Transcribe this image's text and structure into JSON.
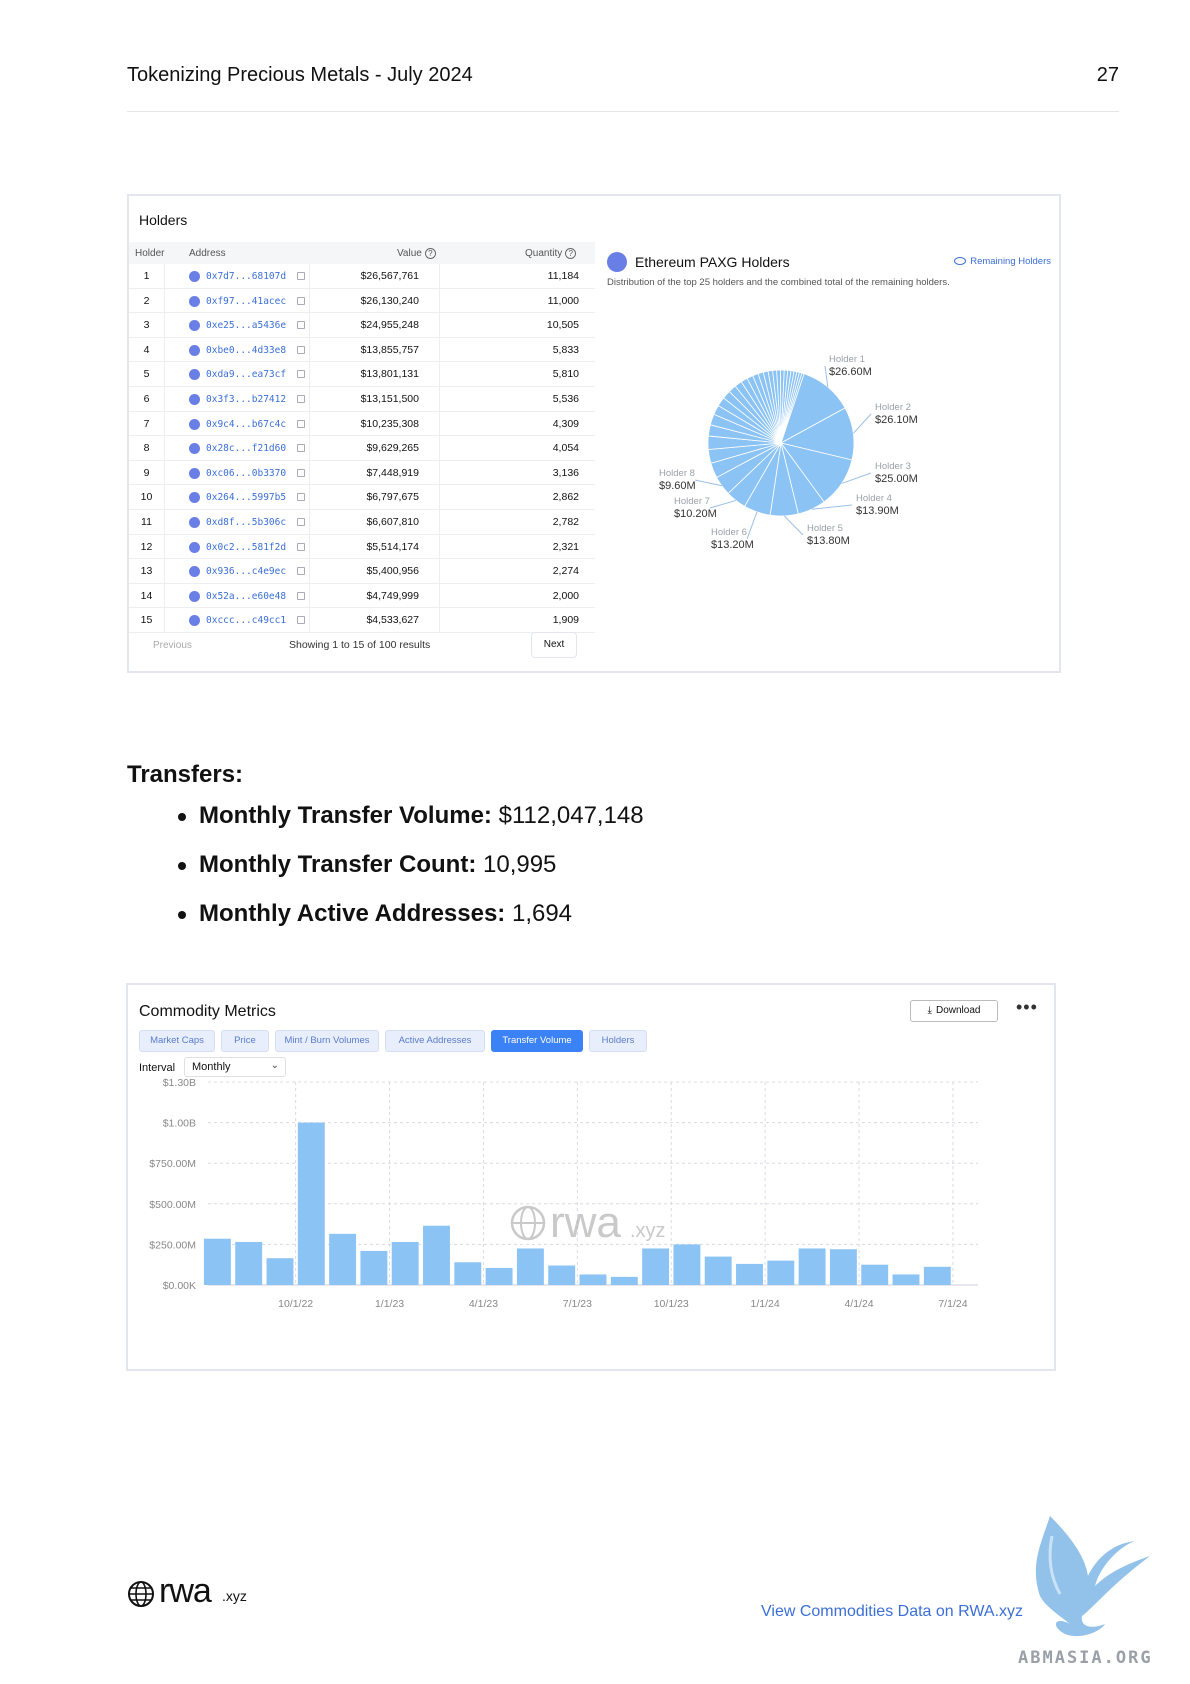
{
  "header": {
    "doc_title": "Tokenizing Precious Metals - July 2024",
    "page_number": "27"
  },
  "holders": {
    "panel_title": "Holders",
    "columns": {
      "holder": "Holder",
      "address": "Address",
      "value": "Value",
      "quantity": "Quantity"
    },
    "rows": [
      {
        "rank": "1",
        "address": "0x7d7...68107d",
        "value": "$26,567,761",
        "quantity": "11,184"
      },
      {
        "rank": "2",
        "address": "0xf97...41acec",
        "value": "$26,130,240",
        "quantity": "11,000"
      },
      {
        "rank": "3",
        "address": "0xe25...a5436e",
        "value": "$24,955,248",
        "quantity": "10,505"
      },
      {
        "rank": "4",
        "address": "0xbe0...4d33e8",
        "value": "$13,855,757",
        "quantity": "5,833"
      },
      {
        "rank": "5",
        "address": "0xda9...ea73cf",
        "value": "$13,801,131",
        "quantity": "5,810"
      },
      {
        "rank": "6",
        "address": "0x3f3...b27412",
        "value": "$13,151,500",
        "quantity": "5,536"
      },
      {
        "rank": "7",
        "address": "0x9c4...b67c4c",
        "value": "$10,235,308",
        "quantity": "4,309"
      },
      {
        "rank": "8",
        "address": "0x28c...f21d60",
        "value": "$9,629,265",
        "quantity": "4,054"
      },
      {
        "rank": "9",
        "address": "0xc06...0b3370",
        "value": "$7,448,919",
        "quantity": "3,136"
      },
      {
        "rank": "10",
        "address": "0x264...5997b5",
        "value": "$6,797,675",
        "quantity": "2,862"
      },
      {
        "rank": "11",
        "address": "0xd8f...5b306c",
        "value": "$6,607,810",
        "quantity": "2,782"
      },
      {
        "rank": "12",
        "address": "0x0c2...581f2d",
        "value": "$5,514,174",
        "quantity": "2,321"
      },
      {
        "rank": "13",
        "address": "0x936...c4e9ec",
        "value": "$5,400,956",
        "quantity": "2,274"
      },
      {
        "rank": "14",
        "address": "0x52a...e60e48",
        "value": "$4,749,999",
        "quantity": "2,000"
      },
      {
        "rank": "15",
        "address": "0xccc...c49cc1",
        "value": "$4,533,627",
        "quantity": "1,909"
      }
    ],
    "pager": {
      "previous": "Previous",
      "showing": "Showing 1 to 15 of 100 results",
      "next": "Next"
    }
  },
  "pie": {
    "title": "Ethereum PAXG Holders",
    "subtitle": "Distribution of the top 25 holders and the combined total of the remaining holders.",
    "remaining_link": "Remaining Holders",
    "color": "#8cc3f5"
  },
  "transfers": {
    "heading": "Transfers:",
    "items": [
      {
        "label": "Monthly Transfer Volume:",
        "value": " $112,047,148"
      },
      {
        "label": "Monthly Transfer Count:",
        "value": " 10,995"
      },
      {
        "label": "Monthly Active Addresses:",
        "value": " 1,694"
      }
    ]
  },
  "metrics": {
    "title": "Commodity Metrics",
    "download": "Download",
    "tabs": [
      "Market Caps",
      "Price",
      "Mint / Burn Volumes",
      "Active Addresses",
      "Transfer Volume",
      "Holders"
    ],
    "active_tab": "Transfer Volume",
    "interval_label": "Interval",
    "interval_value": "Monthly",
    "watermark": {
      "main": "rwa",
      "suffix": ".xyz"
    }
  },
  "chart_data": [
    {
      "type": "pie",
      "title": "Ethereum PAXG Holders",
      "slices": [
        {
          "label": "Holder 1",
          "value": 26.6,
          "display": "$26.60M"
        },
        {
          "label": "Holder 2",
          "value": 26.1,
          "display": "$26.10M"
        },
        {
          "label": "Holder 3",
          "value": 25.0,
          "display": "$25.00M"
        },
        {
          "label": "Holder 4",
          "value": 13.9,
          "display": "$13.90M"
        },
        {
          "label": "Holder 5",
          "value": 13.8,
          "display": "$13.80M"
        },
        {
          "label": "Holder 6",
          "value": 13.2,
          "display": "$13.20M"
        },
        {
          "label": "Holder 7",
          "value": 10.2,
          "display": "$10.20M"
        },
        {
          "label": "Holder 8",
          "value": 9.6,
          "display": "$9.60M"
        }
      ],
      "small_slices": [
        7.45,
        6.8,
        6.61,
        5.51,
        5.4,
        4.75,
        4.53,
        4.2,
        3.9,
        3.6,
        3.3,
        3.0,
        2.8,
        2.6,
        2.4,
        2.2,
        2.0,
        1.9,
        1.8,
        1.7,
        1.6,
        1.5,
        1.4,
        1.3,
        1.2,
        1.1
      ]
    },
    {
      "type": "bar",
      "title": "Transfer Volume",
      "y_ticks": [
        "$0.00K",
        "$250.00M",
        "$500.00M",
        "$750.00M",
        "$1.00B",
        "$1.30B"
      ],
      "y_tick_values": [
        0,
        250,
        500,
        750,
        1000,
        1250
      ],
      "ylim": [
        0,
        1250
      ],
      "x_ticks": [
        "10/1/22",
        "1/1/23",
        "4/1/23",
        "7/1/23",
        "10/1/23",
        "1/1/24",
        "4/1/24",
        "7/1/24"
      ],
      "x_tick_index": [
        2.5,
        5.5,
        8.5,
        11.5,
        14.5,
        17.5,
        20.5,
        23.5
      ],
      "unit": "millions USD",
      "values": [
        285,
        265,
        165,
        1000,
        315,
        210,
        265,
        365,
        140,
        105,
        225,
        120,
        65,
        50,
        225,
        250,
        175,
        130,
        150,
        225,
        220,
        125,
        65,
        112
      ],
      "grid": true,
      "color": "#8cc3f5"
    }
  ],
  "footer": {
    "logo_main": "rwa",
    "logo_suffix": ".xyz",
    "link": "View Commodities Data on RWA.xyz",
    "watermark": "ABMASIA.ORG"
  }
}
